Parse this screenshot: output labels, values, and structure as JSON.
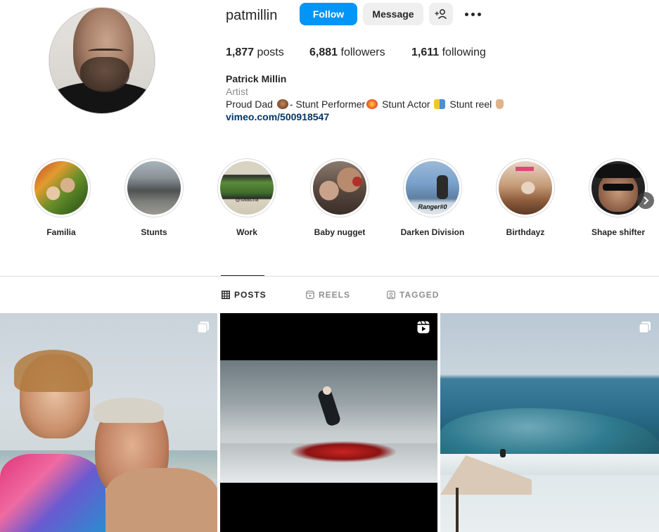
{
  "profile": {
    "username": "patmillin",
    "follow_label": "Follow",
    "message_label": "Message",
    "add_user_label": "+",
    "posts_count": "1,877",
    "posts_label": "posts",
    "followers_count": "6,881",
    "followers_label": "followers",
    "following_count": "1,611",
    "following_label": "following",
    "full_name": "Patrick Millin",
    "category": "Artist",
    "bio_parts": [
      "Proud Dad",
      "- Stunt Performer",
      "Stunt Actor",
      "Stunt reel"
    ],
    "link": "vimeo.com/500918547"
  },
  "highlights": [
    {
      "label": "Familia"
    },
    {
      "label": "Stunts"
    },
    {
      "label": "Work"
    },
    {
      "label": "Baby nugget"
    },
    {
      "label": "Darken Division"
    },
    {
      "label": "Birthdayz"
    },
    {
      "label": "Shape shifter"
    }
  ],
  "highlight_overlays": {
    "work": "@swatcha",
    "darken": "Ranger#0"
  },
  "tabs": [
    {
      "label": "POSTS",
      "active": true
    },
    {
      "label": "REELS",
      "active": false
    },
    {
      "label": "TAGGED",
      "active": false
    }
  ],
  "colors": {
    "accent": "#0095f6",
    "link": "#00376b",
    "muted": "#8e8e8e",
    "text": "#262626"
  },
  "icons": {
    "more": "more-dots-icon",
    "add_user": "add-user-icon",
    "next": "chevron-right-icon",
    "posts_tab": "grid-icon",
    "reels_tab": "reels-icon",
    "tagged_tab": "tagged-icon",
    "carousel": "carousel-icon",
    "reel_badge": "reel-icon"
  }
}
